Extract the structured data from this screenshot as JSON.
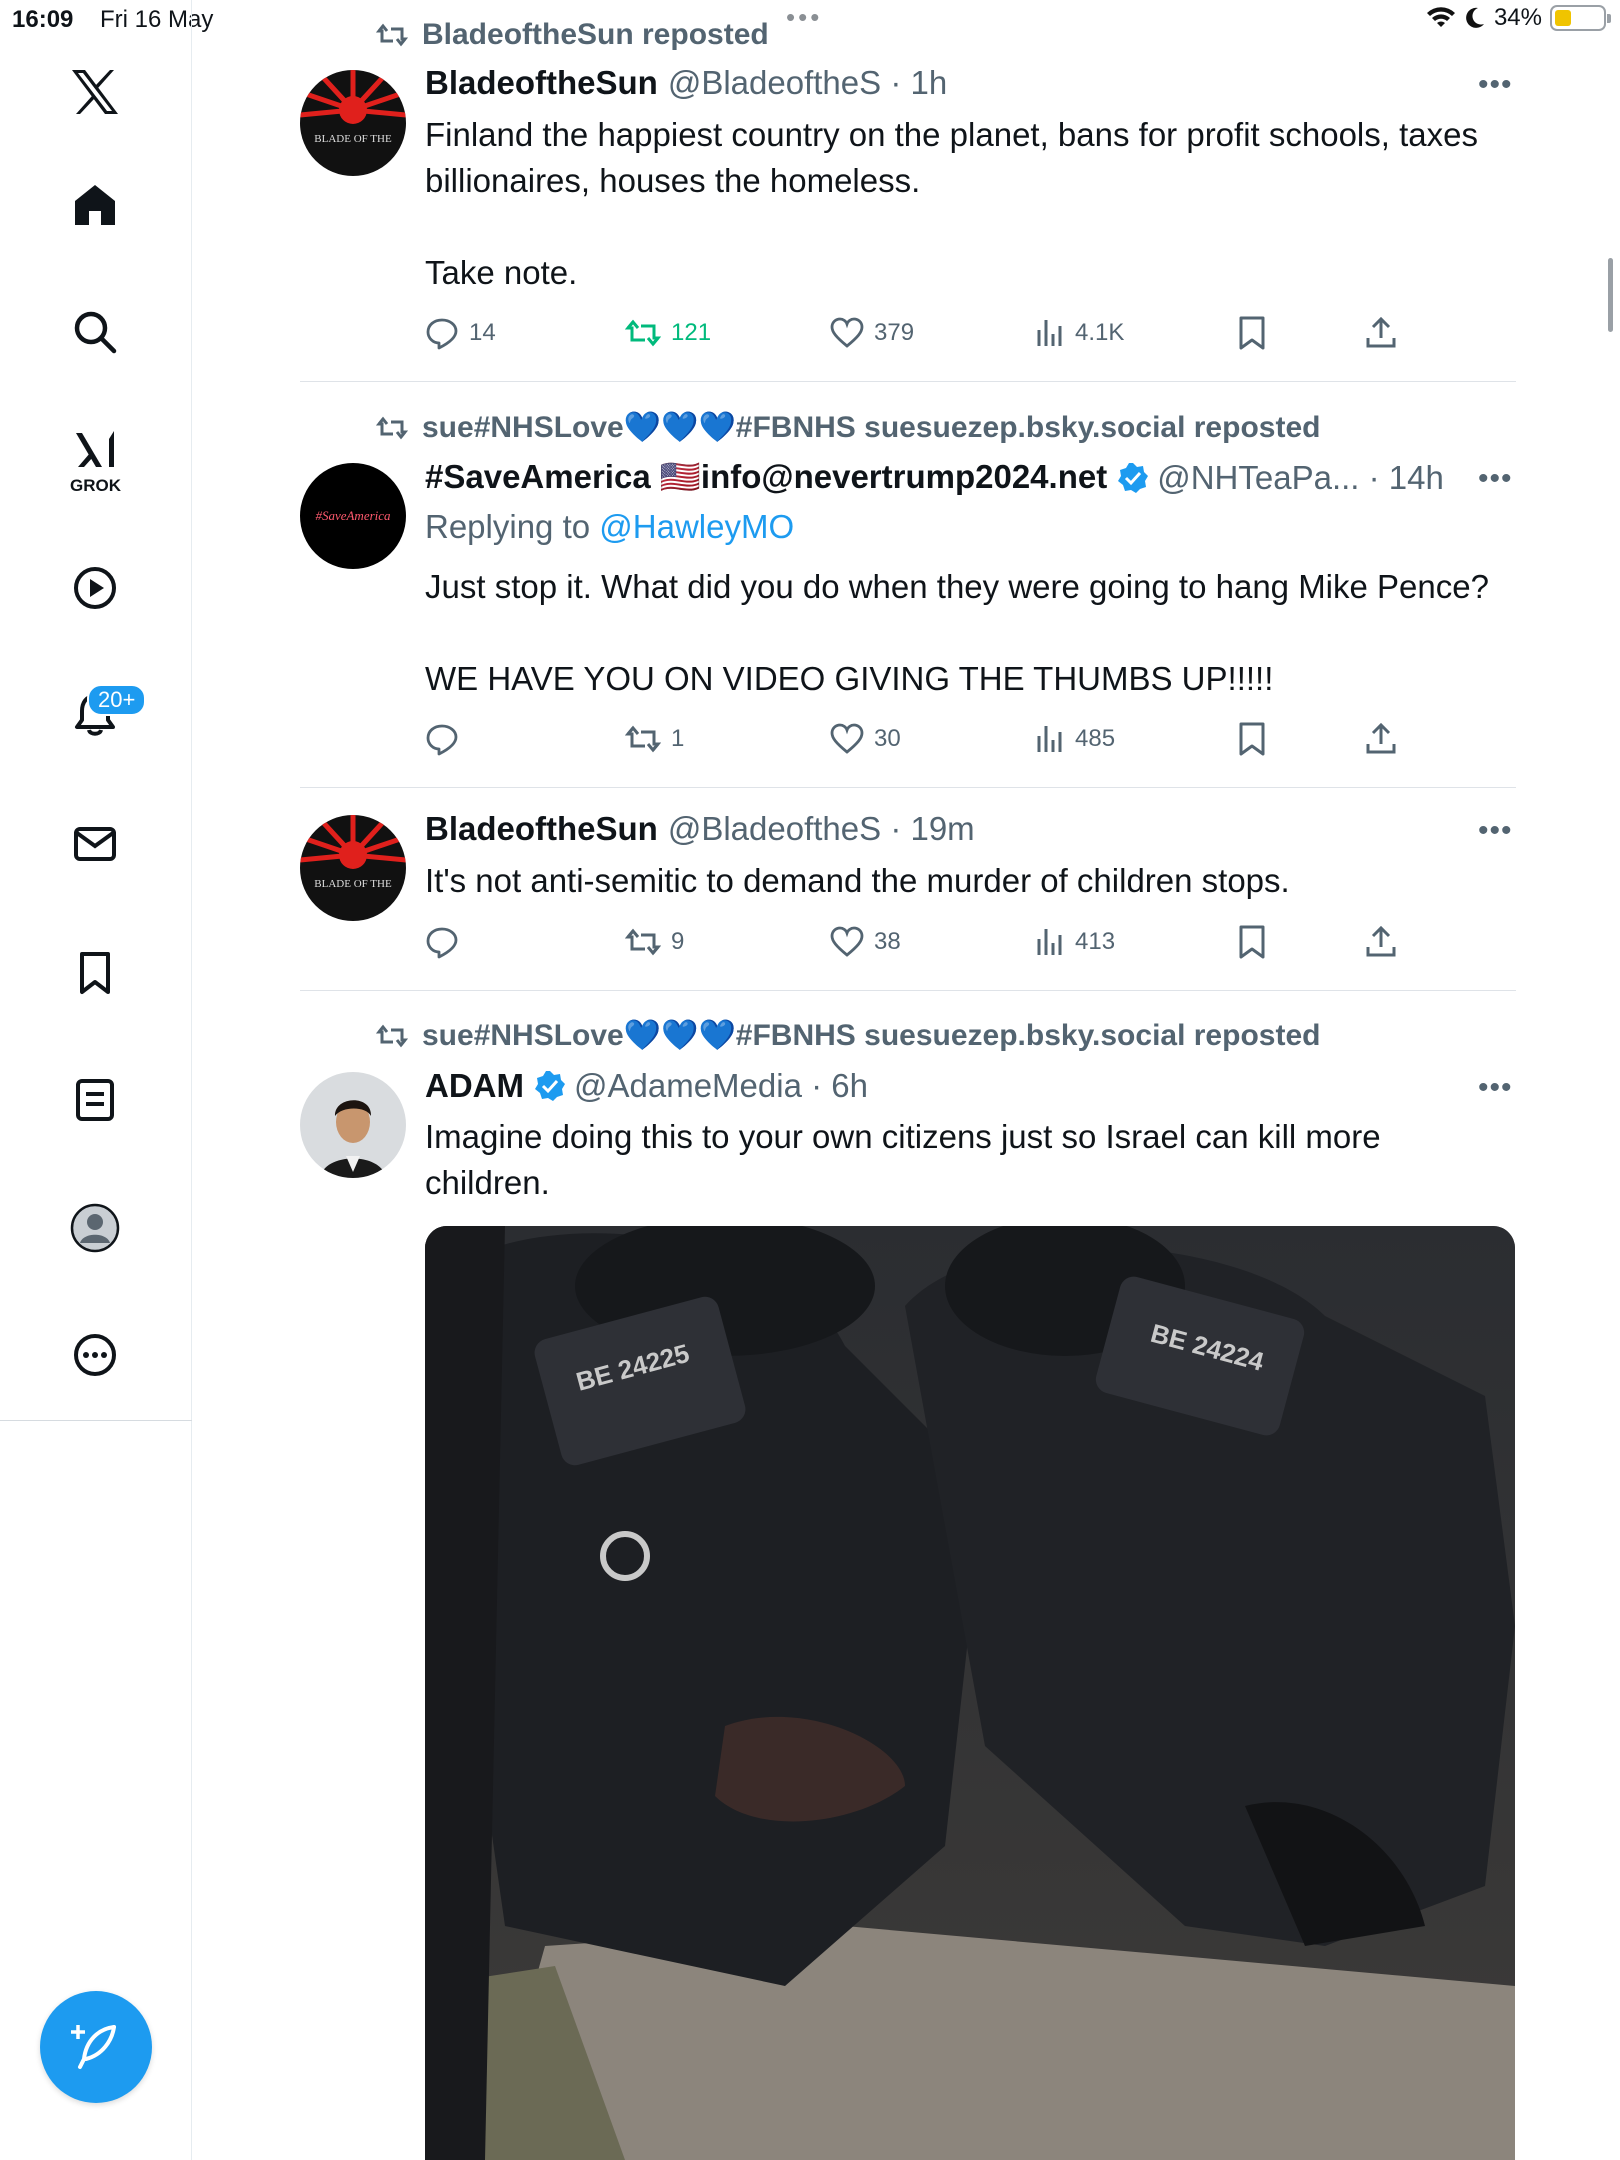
{
  "status_bar": {
    "time": "16:09",
    "date": "Fri 16 May",
    "battery": "34%",
    "battery_level": 0.34
  },
  "sidebar": {
    "grok_label": "GROK",
    "notifications_badge": "20+",
    "icons": [
      "x-logo-icon",
      "home-icon",
      "search-icon",
      "grok-icon",
      "video-icon",
      "bell-icon",
      "mail-icon",
      "bookmark-icon",
      "lists-icon",
      "profile-icon",
      "more-icon"
    ]
  },
  "posts": [
    {
      "repost_label": "BladeoftheSun reposted",
      "name": "BladeoftheSun",
      "handle_time": "@BladeoftheS · 1h",
      "text": "Finland the happiest country on the planet, bans for profit schools, taxes billionaires, houses the homeless.\n\nTake note.",
      "counts": {
        "replies": "14",
        "reposts": "121",
        "likes": "379",
        "views": "4.1K"
      }
    },
    {
      "repost_label": "sue#NHSLove💙💙💙#FBNHS suesuezep.bsky.social reposted",
      "name": "#SaveAmerica 🇺🇸info@nevertrump2024.net",
      "handle_time": "@NHTeaPa... · 14h",
      "replying_prefix": "Replying to",
      "replying_to": "@HawleyMO",
      "text": "Just stop it. What did you do when they were going to hang Mike Pence?\n\nWE HAVE YOU ON VIDEO GIVING THE THUMBS UP!!!!!",
      "counts": {
        "replies": "",
        "reposts": "1",
        "likes": "30",
        "views": "485"
      },
      "avatar_text": "#SaveAmerica"
    },
    {
      "name": "BladeoftheSun",
      "handle_time": "@BladeoftheS · 19m",
      "text": "It's not anti-semitic to demand the murder of children stops.",
      "counts": {
        "replies": "",
        "reposts": "9",
        "likes": "38",
        "views": "413"
      }
    },
    {
      "repost_label": "sue#NHSLove💙💙💙#FBNHS suesuezep.bsky.social reposted",
      "name": "ADAM",
      "handle_time": "@AdameMedia · 6h",
      "text": "Imagine doing this to your own citizens just so Israel can kill more children.",
      "media": {
        "label_left": "BE 24225",
        "label_right": "BE 24224"
      }
    }
  ],
  "blade_avatar_text": "BLADE OF THE",
  "more_glyph": "•••"
}
